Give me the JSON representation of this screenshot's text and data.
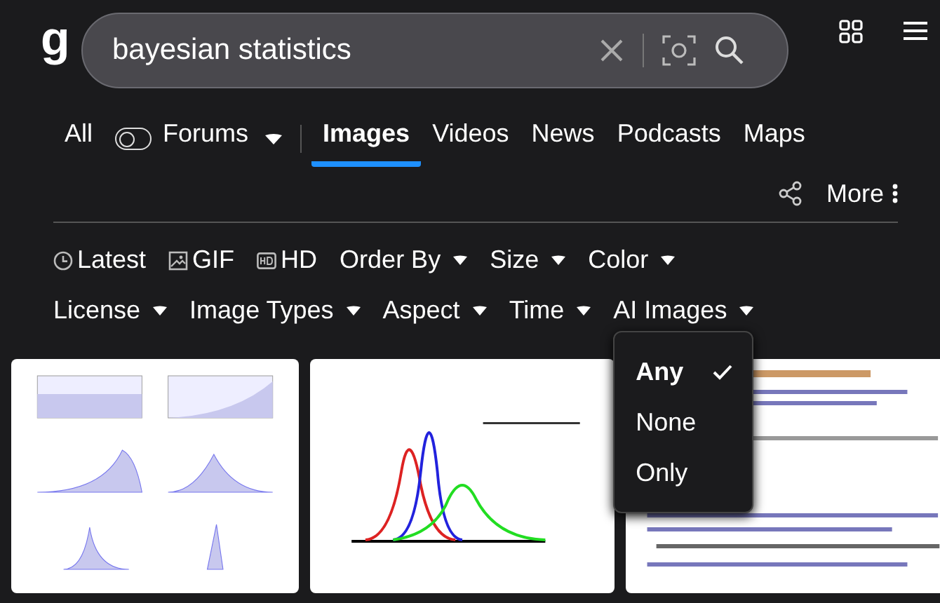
{
  "logo": {
    "text": "g"
  },
  "search": {
    "value": "bayesian statistics"
  },
  "tabs": [
    {
      "label": "All",
      "selected": false,
      "kind": "plain"
    },
    {
      "label": "Forums",
      "selected": false,
      "kind": "toggle",
      "on": false
    },
    {
      "label": "Images",
      "selected": true,
      "kind": "plain"
    },
    {
      "label": "Videos",
      "selected": false,
      "kind": "plain"
    },
    {
      "label": "News",
      "selected": false,
      "kind": "plain"
    },
    {
      "label": "Podcasts",
      "selected": false,
      "kind": "plain"
    },
    {
      "label": "Maps",
      "selected": false,
      "kind": "plain"
    }
  ],
  "more": {
    "label": "More"
  },
  "filter_rows": [
    [
      {
        "label": "Latest",
        "kind": "clock"
      },
      {
        "label": "GIF",
        "kind": "gif"
      },
      {
        "label": "HD",
        "kind": "hd"
      },
      {
        "label": "Order By",
        "kind": "dropdown"
      },
      {
        "label": "Size",
        "kind": "dropdown"
      },
      {
        "label": "Color",
        "kind": "dropdown"
      }
    ],
    [
      {
        "label": "License",
        "kind": "dropdown"
      },
      {
        "label": "Image Types",
        "kind": "dropdown"
      },
      {
        "label": "Aspect",
        "kind": "dropdown"
      },
      {
        "label": "Time",
        "kind": "dropdown"
      },
      {
        "label": "AI Images",
        "kind": "dropdown",
        "expanded": true,
        "options": [
          {
            "label": "Any",
            "selected": true
          },
          {
            "label": "None",
            "selected": false
          },
          {
            "label": "Only",
            "selected": false
          }
        ]
      }
    ]
  ],
  "results": [
    {
      "kind": "picture"
    },
    {
      "kind": "picture"
    },
    {
      "kind": "picture"
    }
  ]
}
